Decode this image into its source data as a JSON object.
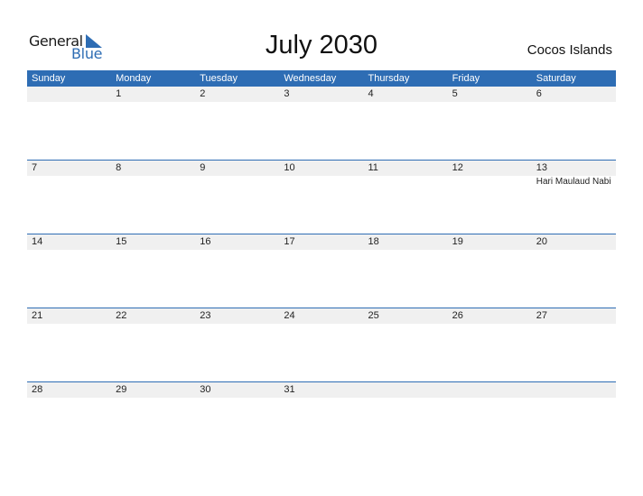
{
  "logo": {
    "line1": "General",
    "line2": "Blue"
  },
  "header": {
    "title": "July 2030",
    "country": "Cocos Islands"
  },
  "colors": {
    "accent": "#2e6db4",
    "strip": "#f0f0f0"
  },
  "weekdays": [
    "Sunday",
    "Monday",
    "Tuesday",
    "Wednesday",
    "Thursday",
    "Friday",
    "Saturday"
  ],
  "weeks": [
    {
      "days": [
        "",
        "1",
        "2",
        "3",
        "4",
        "5",
        "6"
      ],
      "events": [
        "",
        "",
        "",
        "",
        "",
        "",
        ""
      ]
    },
    {
      "days": [
        "7",
        "8",
        "9",
        "10",
        "11",
        "12",
        "13"
      ],
      "events": [
        "",
        "",
        "",
        "",
        "",
        "",
        "Hari Maulaud Nabi"
      ]
    },
    {
      "days": [
        "14",
        "15",
        "16",
        "17",
        "18",
        "19",
        "20"
      ],
      "events": [
        "",
        "",
        "",
        "",
        "",
        "",
        ""
      ]
    },
    {
      "days": [
        "21",
        "22",
        "23",
        "24",
        "25",
        "26",
        "27"
      ],
      "events": [
        "",
        "",
        "",
        "",
        "",
        "",
        ""
      ]
    },
    {
      "days": [
        "28",
        "29",
        "30",
        "31",
        "",
        "",
        ""
      ],
      "events": [
        "",
        "",
        "",
        "",
        "",
        "",
        ""
      ]
    }
  ]
}
